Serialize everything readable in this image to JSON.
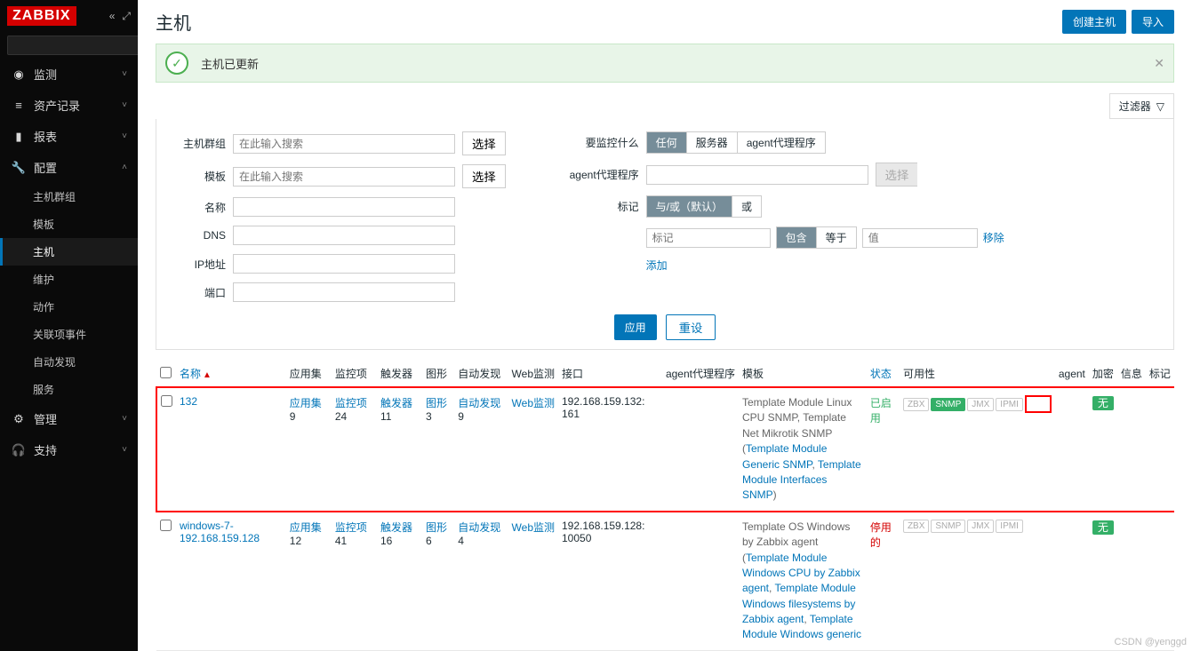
{
  "logo": "ZABBIX",
  "sidebar": {
    "search_placeholder": "",
    "items": [
      {
        "icon": "◉",
        "label": "监测"
      },
      {
        "icon": "≡",
        "label": "资产记录"
      },
      {
        "icon": "▮",
        "label": "报表"
      },
      {
        "icon": "🔧",
        "label": "配置",
        "expanded": true,
        "subs": [
          {
            "label": "主机群组"
          },
          {
            "label": "模板"
          },
          {
            "label": "主机",
            "active": true
          },
          {
            "label": "维护"
          },
          {
            "label": "动作"
          },
          {
            "label": "关联项事件"
          },
          {
            "label": "自动发现"
          },
          {
            "label": "服务"
          }
        ]
      },
      {
        "icon": "⚙",
        "label": "管理"
      },
      {
        "icon": "🎧",
        "label": "支持"
      }
    ]
  },
  "header": {
    "title": "主机",
    "create_btn": "创建主机",
    "import_btn": "导入"
  },
  "message": {
    "text": "主机已更新"
  },
  "filter": {
    "toggle_label": "过滤器",
    "left_labels": {
      "hostgroup": "主机群组",
      "template": "模板",
      "name": "名称",
      "dns": "DNS",
      "ip": "IP地址",
      "port": "端口"
    },
    "placeholder": "在此输入搜索",
    "select_btn": "选择",
    "right_labels": {
      "monitor": "要监控什么",
      "proxy": "agent代理程序",
      "tag": "标记"
    },
    "monitor_opts": [
      "任何",
      "服务器",
      "agent代理程序"
    ],
    "tag_mode": [
      "与/或（默认）",
      "或"
    ],
    "tag_fields": {
      "tag_ph": "标记",
      "op1": "包含",
      "op2": "等于",
      "val_ph": "值",
      "remove": "移除",
      "add": "添加"
    },
    "apply": "应用",
    "reset": "重设"
  },
  "table": {
    "cols": {
      "name": "名称",
      "app": "应用集",
      "items": "监控项",
      "trig": "触发器",
      "graph": "图形",
      "disc": "自动发现",
      "web": "Web监测",
      "iface": "接口",
      "proxy": "agent代理程序",
      "tmpl": "模板",
      "status": "状态",
      "avail": "可用性",
      "agent": "agent",
      "enc": "加密",
      "info": "信息",
      "tag": "标记"
    },
    "rows": [
      {
        "highlight": true,
        "name": "132",
        "app": {
          "label": "应用集",
          "n": "9"
        },
        "items": {
          "label": "监控项",
          "n": "24"
        },
        "trig": {
          "label": "触发器",
          "n": "11"
        },
        "graph": {
          "label": "图形",
          "n": "3"
        },
        "disc": {
          "label": "自动发现",
          "n": "9"
        },
        "web": "Web监测",
        "iface": "192.168.159.132: 161",
        "tmpl_plain": "Template Module Linux CPU SNMP, Template Net Mikrotik SNMP (",
        "tmpl_links": [
          "Template Module Generic SNMP",
          "Template Module Interfaces SNMP"
        ],
        "tmpl_tail": ")",
        "status": "已启用",
        "status_class": "green",
        "avail": [
          "ZBX",
          "SNMP",
          "JMX",
          "IPMI"
        ],
        "avail_green_idx": 1,
        "enc": "无",
        "redbox": true
      },
      {
        "highlight": false,
        "name": "windows-7-192.168.159.128",
        "app": {
          "label": "应用集",
          "n": "12"
        },
        "items": {
          "label": "监控项",
          "n": "41"
        },
        "trig": {
          "label": "触发器",
          "n": "16"
        },
        "graph": {
          "label": "图形",
          "n": "6"
        },
        "disc": {
          "label": "自动发现",
          "n": "4"
        },
        "web": "Web监测",
        "iface": "192.168.159.128: 10050",
        "tmpl_plain": "Template OS Windows by Zabbix agent (",
        "tmpl_links": [
          "Template Module Windows CPU by Zabbix agent",
          "Template Module Windows filesystems by Zabbix agent",
          "Template Module Windows generic"
        ],
        "tmpl_tail": "",
        "status": "停用的",
        "status_class": "red",
        "avail": [
          "ZBX",
          "SNMP",
          "JMX",
          "IPMI"
        ],
        "avail_green_idx": -1,
        "enc": "无",
        "redbox": false
      }
    ]
  },
  "watermark": "CSDN @yenggd"
}
